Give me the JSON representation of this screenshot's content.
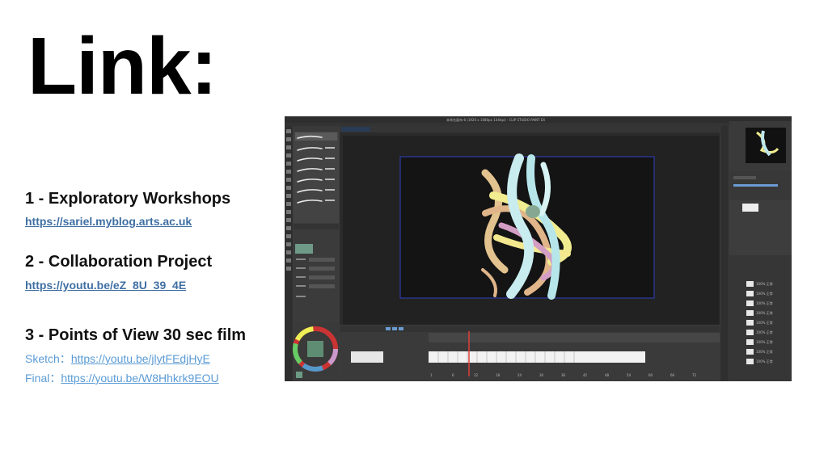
{
  "title": "Link:",
  "sections": [
    {
      "heading": "1 - Exploratory Workshops",
      "link": "https://sariel.myblog.arts.ac.uk"
    },
    {
      "heading": "2 - Collaboration Project",
      "link": "https://youtu.be/eZ_8U_39_4E"
    },
    {
      "heading": "3 - Points of View 30 sec film",
      "sketch_label": "Sketch：",
      "sketch_link": "https://youtu.be/jlytFEdjHyE",
      "final_label": "Final：",
      "final_link": "https://youtu.be/W8Hhkrk9EOU"
    }
  ],
  "screenshot": {
    "window_title": "未命名画布-6 (1920 x 1080px 144dpi) - CLIP STUDIO PAINT EX",
    "frame_ticks": [
      "1",
      "6",
      "12",
      "18",
      "24",
      "30",
      "36",
      "42",
      "48",
      "54",
      "60",
      "66",
      "72"
    ],
    "layer_labels": [
      "100% 正常",
      "100% 正常",
      "100% 正常",
      "100% 正常",
      "100% 正常",
      "100% 正常",
      "100% 正常",
      "100% 正常",
      "100% 正常"
    ],
    "colors": {
      "accent": "#6b9bd2",
      "canvas_border": "#2c3aa5",
      "playhead": "#e0403a"
    }
  }
}
